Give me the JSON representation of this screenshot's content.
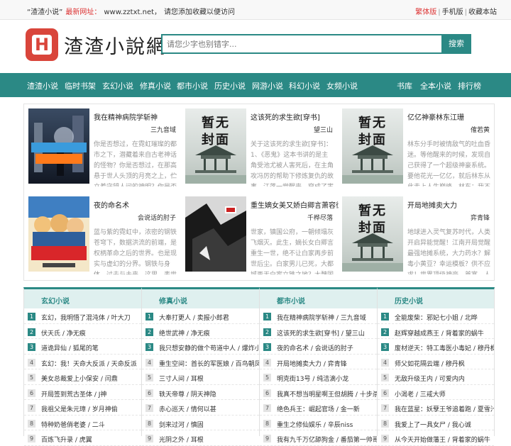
{
  "topbar": {
    "site_name": "“渣渣小说”",
    "latest_label": "最新网址：",
    "url": "www.zztxt.net，",
    "tip": "请您添加收藏以便访问",
    "fanti": "繁体版",
    "mobile": "手机版",
    "bookmark": "收藏本站",
    "sep": "|"
  },
  "header": {
    "logo_letter": "H",
    "logo_text": "渣渣小說網",
    "search_placeholder": "请您少字也别错字...",
    "search_button": "搜索"
  },
  "nav": {
    "items": [
      "渣渣小说",
      "临时书架",
      "玄幻小说",
      "修真小说",
      "都市小说",
      "历史小说",
      "网游小说",
      "科幻小说",
      "女频小说"
    ],
    "right_items": [
      "书库",
      "全本小说",
      "排行榜"
    ]
  },
  "colors": {
    "accent": "#2b8985",
    "brand_red": "#d9453b",
    "link_red": "#dd3333"
  },
  "nocover_text": [
    "暂无",
    "封面"
  ],
  "featured": [
    {
      "title": "我在精神病院学斩神",
      "author": "三九音域",
      "desc": "你是否想过，在霓虹璀璨的都市之下，潜藏着来自古老神话的怪物？你是否想过，在那高悬于世人头顶的月亮之上，伫立着守望人间的神明？你是否想过，在",
      "cover": "art1"
    },
    {
      "title": "这该死的求生欲[穿书]",
      "author": "望三山",
      "desc": "关于这该死的求生欲[穿书]：1、《恶鬼》这本书讲的是主角受池尤被人害死后，在主角攻冯厉的帮助下修炼复仇的故事。江落一觉醒来，穿成了害死主角受的",
      "cover": "nocover"
    },
    {
      "title": "亿亿神豪林东江珊",
      "author": "傕若黄",
      "desc": "林东分手时被情敌气的吐血昏迷。等他醒来的时候，发现自己获得了一个超级神豪系统。要他花光一亿亿，就后林东从此走上人生巅峰。林东：我不装了，我是",
      "cover": "nocover"
    },
    {
      "title": "夜的命名术",
      "author": "会说话的肘子",
      "desc": "蓝与紫的霓虹中，浓密的钢铁苍穹下，数据洪流的前端，是权柄革命之后的世界。也是现实与虚幻的分界。钢铁与身体，过去与未来。这里，表世界与里世界开",
      "cover": "art2"
    },
    {
      "title": "重生嫡女美又娇白卿言萧容衍",
      "author": "千桦尽落",
      "desc": "世家，镇国公府，一朝倾塌灰飞烟灭。此生，嫡长女白卿言重生一世，绝不让白家再步前世后尘。白家男儿已死，大都城再无白家立锥之地？大魏国富商萧容衍",
      "cover": "art3"
    },
    {
      "title": "开局地摊卖大力",
      "author": "弈青锋",
      "desc": "地球进入灵气复苏时代，人类开启异能觉醒！江南开局觉醒最强地摊系统，大力药水？解毒小黄豆？幸运模板？供不应求！世界顶级神豪，首富，人气主播，最",
      "cover": "nocover"
    }
  ],
  "lists": [
    {
      "title": "玄幻小说",
      "items": [
        "玄幻，我明悟了混沌体 / 叶大刀",
        "伏天氏 / 净无痕",
        "道诡异仙 / 狐尾的笔",
        "玄幻：我！天命大反派 / 天命反派",
        "美女总裁爱上小保安 / 闫鼎",
        "开局签到荒古圣体 / J神",
        "我祖父是朱元璋 / 岁月神偷",
        "特种奶爸俏老婆 / 二斗",
        "百炼飞升录 / 虎翼"
      ]
    },
    {
      "title": "修真小说",
      "items": [
        "大奉打更人 / 卖报小郎君",
        "绝世武神 / 净无痕",
        "我只想安静的做个苟道中人 / 爆炸小",
        "重生空间：首长的军医娘 / 百鸟朝凤",
        "三寸人间 / 耳根",
        "轶天帝尊 / 阴天神隐",
        "赤心巡天 / 情何以甚",
        "剑来过河 / 慎固",
        "光阴之外 / 耳根"
      ]
    },
    {
      "title": "都市小说",
      "items": [
        "我在精神病院学斩神 / 三九音域",
        "这该死的求生欲[穿书] / 望三山",
        "夜的命名术 / 会说话的肘子",
        "开局地摊卖大力 / 弈青锋",
        "明克街13号 / 纯洁滴小龙",
        "我真不想当明星啊王但胡腾 / 十步杀",
        "绝色兵王：崛起官场 / 金一新",
        "重生之修仙娱乐 / 辛辰niss",
        "我有九千万亿舔狗金 / 番茄第一帅哥"
      ]
    },
    {
      "title": "历史小说",
      "items": [
        "全能废柴：邪妃七小姐 / 北晔",
        "赵辉穿越成燕王 / 背着家的蜗牛",
        "废材逆天：特工毒医小毒妃 / 穆丹枫",
        "师父如花隔云端 / 穆丹枫",
        "无敌升级王内 / 可爱内内",
        "小渴老 / 三戒大师",
        "我在蓝星：妖孽王爷追着跑 / 夏雪汁",
        "我爱上了一具女尸 / 我心诚",
        "从今天开始做藩王 / 背着家的蜗牛"
      ]
    }
  ]
}
